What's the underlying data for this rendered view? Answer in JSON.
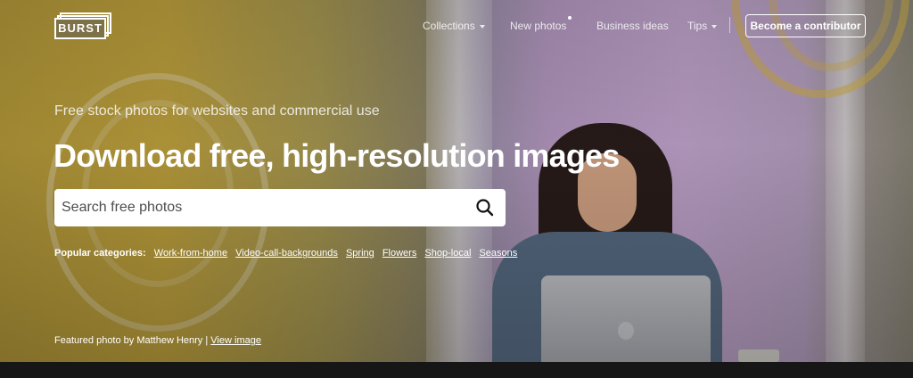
{
  "brand": {
    "logo_text": "BURST"
  },
  "nav": {
    "items": [
      {
        "label": "Collections",
        "has_dropdown": true
      },
      {
        "label": "New photos",
        "has_dot": true
      },
      {
        "label": "Business ideas"
      },
      {
        "label": "Tips",
        "has_dropdown": true
      }
    ],
    "cta_label": "Become a contributor"
  },
  "hero": {
    "subtitle": "Free stock photos for websites and commercial use",
    "headline": "Download free, high-resolution images",
    "search": {
      "placeholder": "Search free photos",
      "value": ""
    },
    "popular": {
      "label": "Popular categories:",
      "categories": [
        "Work-from-home",
        "Video-call-backgrounds",
        "Spring",
        "Flowers",
        "Shop-local",
        "Seasons"
      ]
    },
    "featured": {
      "prefix": "Featured photo by Matthew Henry |",
      "link_label": "View image"
    }
  },
  "icons": {
    "search": "search-icon",
    "dropdown": "caret-down-icon"
  },
  "colors": {
    "bottom_bar": "#161616",
    "text": "#ffffff"
  }
}
